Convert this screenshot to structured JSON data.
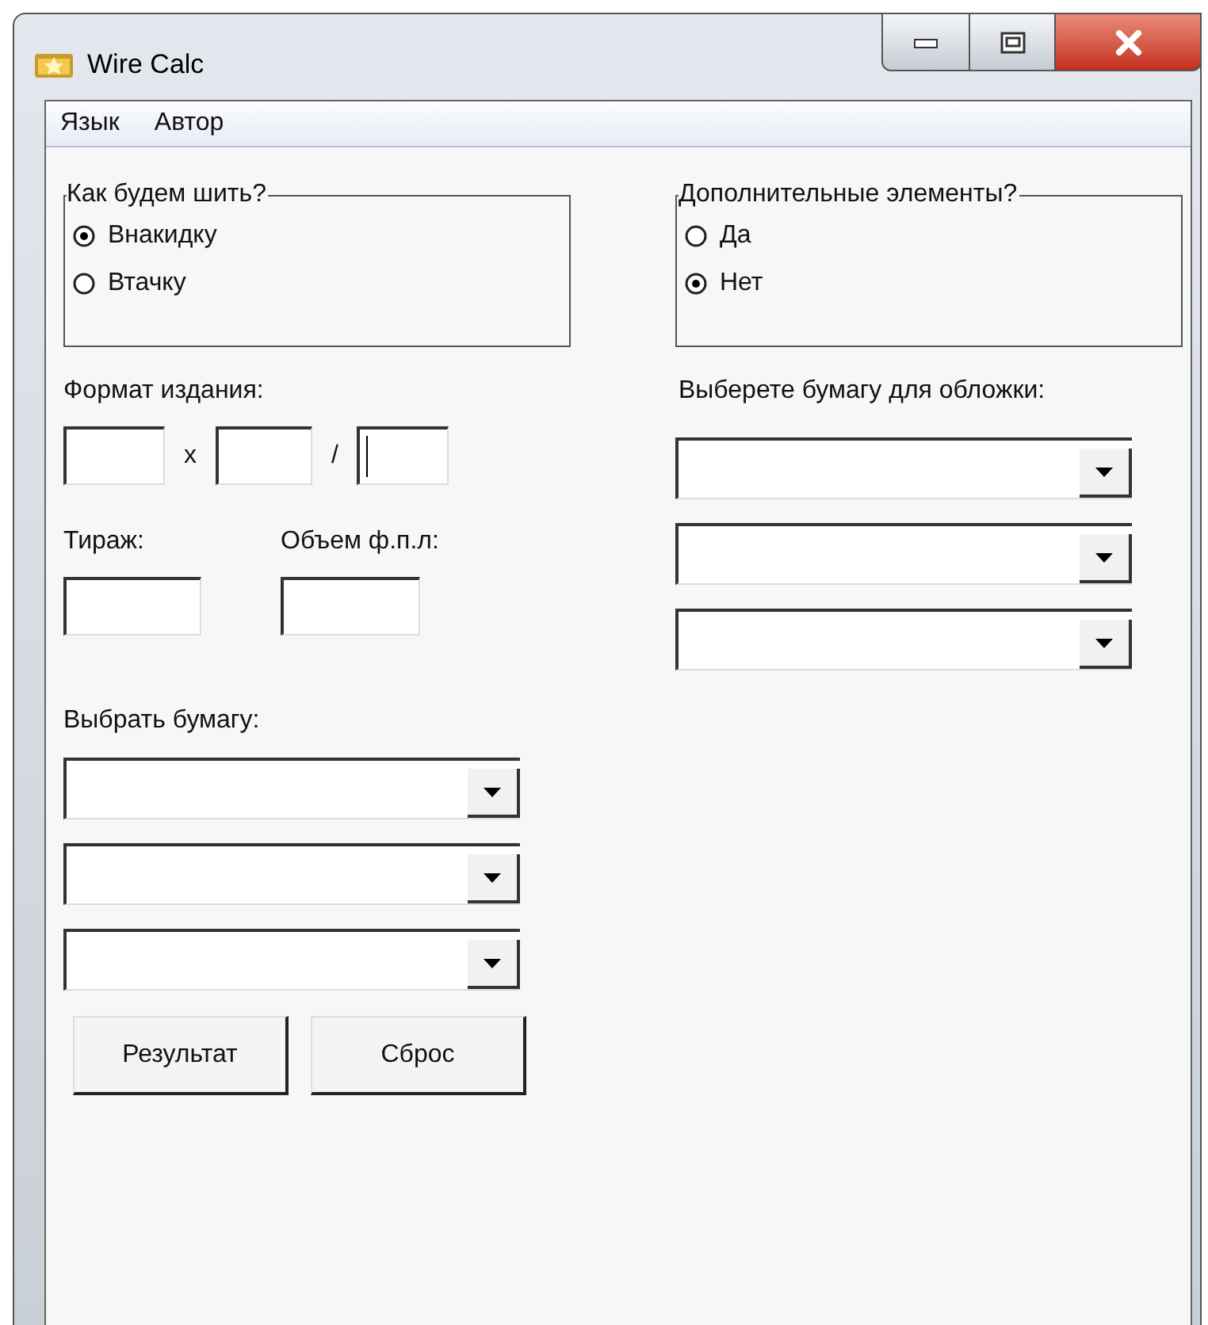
{
  "window": {
    "title": "Wire Calc"
  },
  "menu": [
    {
      "label": "Язык"
    },
    {
      "label": "Автор"
    }
  ],
  "stitch_group": {
    "title": "Как будем шить?",
    "options": [
      {
        "label": "Внакидку",
        "selected": true
      },
      {
        "label": "Втачку",
        "selected": false
      }
    ]
  },
  "extras_group": {
    "title": "Дополнительные элементы?",
    "options": [
      {
        "label": "Да",
        "selected": false
      },
      {
        "label": "Нет",
        "selected": true
      }
    ]
  },
  "format": {
    "label": "Формат издания:",
    "separators": [
      "x",
      "/"
    ],
    "fields": [
      {
        "focused": false
      },
      {
        "focused": false
      },
      {
        "focused": true
      }
    ]
  },
  "print_run": {
    "label": "Тираж:"
  },
  "volume": {
    "label": "Объем ф.п.л:"
  },
  "paper": {
    "label": "Выбрать бумагу:",
    "dropdowns": [
      {
        "kind": "combo"
      },
      {
        "kind": "combo"
      },
      {
        "kind": "combo"
      }
    ]
  },
  "buttons": [
    {
      "label": "Результат"
    },
    {
      "label": "Сброс"
    }
  ],
  "cover_paper": {
    "label": "Выберете бумагу для обложки:",
    "dropdowns": [
      {
        "kind": "combo"
      },
      {
        "kind": "combo"
      },
      {
        "kind": "combo"
      }
    ]
  }
}
